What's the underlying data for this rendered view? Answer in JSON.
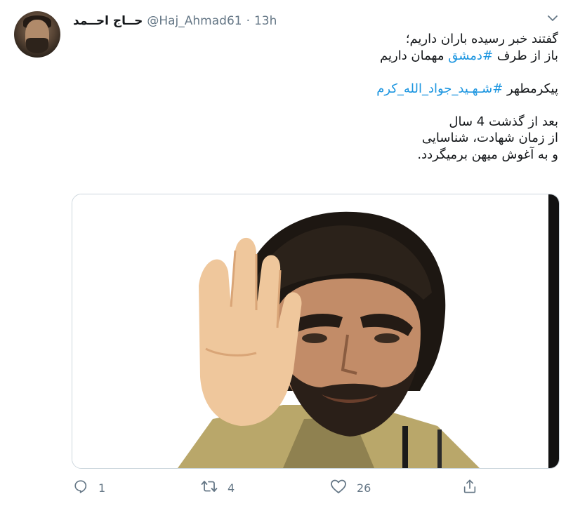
{
  "tweet": {
    "display_name": "حــاج احــمد",
    "handle": "@Haj_Ahmad61",
    "separator": "·",
    "time": "13h",
    "lines": [
      {
        "parts": [
          {
            "text": "گفتند خبر رسیده باران داریم؛",
            "hashtag": false
          }
        ]
      },
      {
        "parts": [
          {
            "text": "باز از طرف ",
            "hashtag": false
          },
          {
            "text": "#دمشق",
            "hashtag": true
          },
          {
            "text": " مهمان داریم",
            "hashtag": false
          }
        ]
      },
      {
        "parts": []
      },
      {
        "parts": [
          {
            "text": "پیکرمطهر ",
            "hashtag": false
          },
          {
            "text": "#شـهـید_جواد_الله_کرم",
            "hashtag": true
          }
        ]
      },
      {
        "parts": []
      },
      {
        "parts": [
          {
            "text": "بعد از گذشت 4 سال",
            "hashtag": false
          }
        ]
      },
      {
        "parts": [
          {
            "text": "از زمان شهادت، شناسایی",
            "hashtag": false
          }
        ]
      },
      {
        "parts": [
          {
            "text": "و به آغوش میهن برمیگردد.",
            "hashtag": false
          }
        ]
      }
    ]
  },
  "actions": {
    "reply": {
      "icon": "reply-icon",
      "count": "1"
    },
    "retweet": {
      "icon": "retweet-icon",
      "count": "4"
    },
    "like": {
      "icon": "heart-icon",
      "count": "26"
    },
    "share": {
      "icon": "share-icon",
      "count": ""
    }
  },
  "colors": {
    "hashtag": "#1b95e0",
    "muted": "#657786",
    "text": "#14171a",
    "border": "#ccd6dd"
  }
}
